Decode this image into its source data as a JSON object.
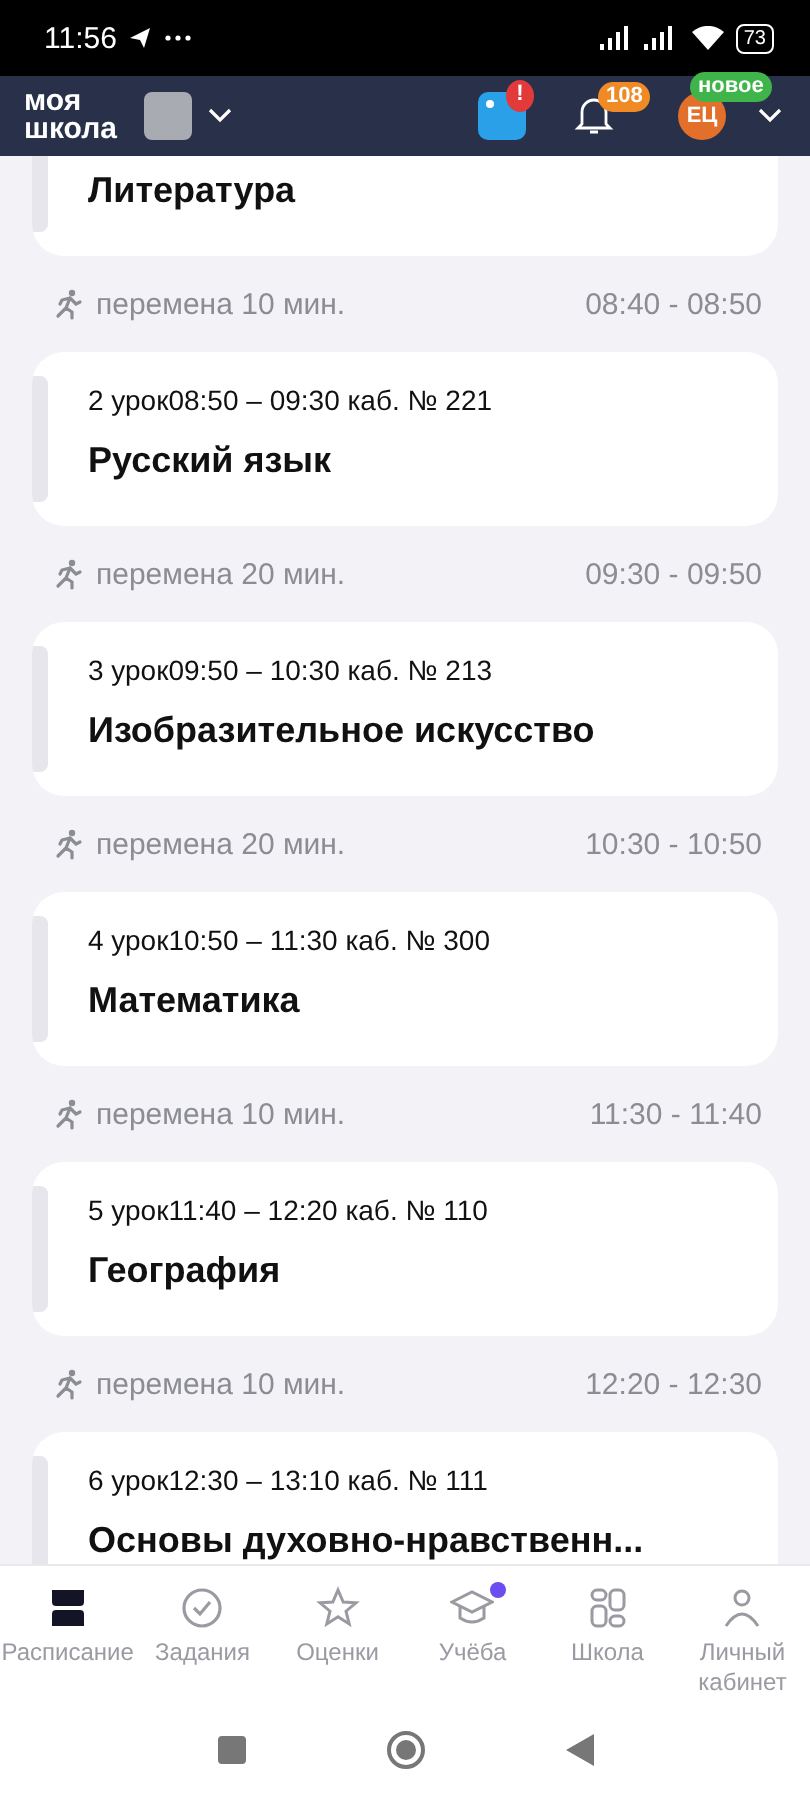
{
  "status_bar": {
    "time": "11:56",
    "battery": "73"
  },
  "header": {
    "logo": "моя школа",
    "alert_badge": "!",
    "notifications": "108",
    "avatar": "ЕЦ",
    "avatar_badge": "новое"
  },
  "schedule": [
    {
      "kind": "lesson",
      "title": "Литература"
    },
    {
      "kind": "break",
      "label": "перемена 10 мин.",
      "time": "08:40 - 08:50"
    },
    {
      "kind": "lesson",
      "meta": "2 урок08:50 – 09:30 каб. № 221",
      "title": "Русский язык"
    },
    {
      "kind": "break",
      "label": "перемена 20 мин.",
      "time": "09:30 - 09:50"
    },
    {
      "kind": "lesson",
      "meta": "3 урок09:50 – 10:30 каб. № 213",
      "title": "Изобразительное искусство"
    },
    {
      "kind": "break",
      "label": "перемена 20 мин.",
      "time": "10:30 - 10:50"
    },
    {
      "kind": "lesson",
      "meta": "4 урок10:50 – 11:30 каб. № 300",
      "title": "Математика"
    },
    {
      "kind": "break",
      "label": "перемена 10 мин.",
      "time": "11:30 - 11:40"
    },
    {
      "kind": "lesson",
      "meta": "5 урок11:40 – 12:20 каб. № 110",
      "title": "География"
    },
    {
      "kind": "break",
      "label": "перемена 10 мин.",
      "time": "12:20 - 12:30"
    },
    {
      "kind": "lesson",
      "meta": "6 урок12:30 – 13:10 каб. № 111",
      "title": "Основы духовно-нравственн..."
    }
  ],
  "tabs": [
    {
      "kind": "schedule",
      "label": "Расписание",
      "selected": true,
      "dot": false
    },
    {
      "kind": "tasks",
      "label": "Задания",
      "selected": false,
      "dot": false
    },
    {
      "kind": "grades",
      "label": "Оценки",
      "selected": false,
      "dot": false
    },
    {
      "kind": "study",
      "label": "Учёба",
      "selected": false,
      "dot": true
    },
    {
      "kind": "school",
      "label": "Школа",
      "selected": false,
      "dot": false
    },
    {
      "kind": "profile",
      "label": "Личный кабинет",
      "selected": false,
      "dot": false
    }
  ]
}
